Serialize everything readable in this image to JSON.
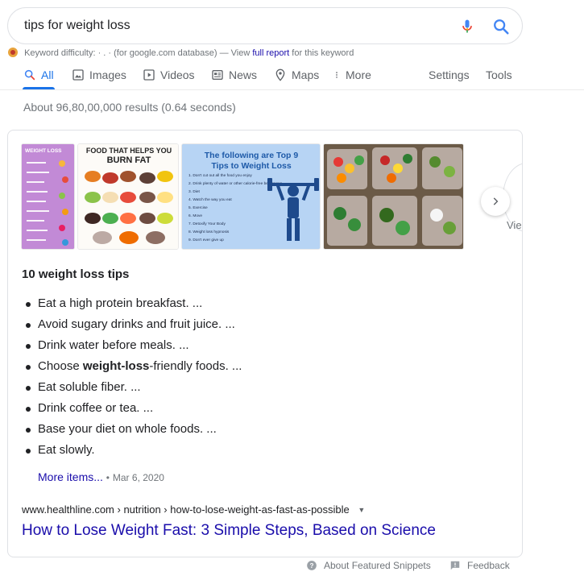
{
  "search": {
    "query": "tips for weight loss"
  },
  "keyword_difficulty": {
    "label": "Keyword difficulty:",
    "value": "· . ·",
    "note": "(for google.com database) — View",
    "link": "full report",
    "tail": "for this keyword"
  },
  "tabs": {
    "all": "All",
    "images": "Images",
    "videos": "Videos",
    "news": "News",
    "maps": "Maps",
    "more": "More",
    "settings": "Settings",
    "tools": "Tools"
  },
  "results_count": "About 96,80,00,000 results (0.64 seconds)",
  "images": [
    {
      "title": "WEIGHT LOSS",
      "icon": "weight-loss-checklist-image"
    },
    {
      "title": "FOOD THAT HELPS YOU",
      "title2": "BURN FAT",
      "icon": "fat-burning-food-image"
    },
    {
      "title": "The following are Top 9",
      "title2": "Tips to Weight Loss",
      "icon": "top-nine-tips-image",
      "tips": [
        "1.  Don't cut out all the food you enjoy",
        "2.  Drink plenty of water or other calorie-free beverages",
        "3.  Diet",
        "4.  Watch the way you eat",
        "5.  Exercise",
        "6.  Move",
        "7.  Detoxify Your Body",
        "8.  Weight loss hypnosis",
        "9.  Don't ever give up"
      ]
    },
    {
      "title": "",
      "icon": "meal-prep-containers-image"
    }
  ],
  "view_all": "Vie",
  "snippet": {
    "title": "10 weight loss tips",
    "items": [
      {
        "text": "Eat a high protein breakfast. ..."
      },
      {
        "text": "Avoid sugary drinks and fruit juice. ..."
      },
      {
        "text": "Drink water before meals. ..."
      },
      {
        "pre": "Choose ",
        "bold": "weight-loss",
        "post": "-friendly foods. ..."
      },
      {
        "text": "Eat soluble fiber. ..."
      },
      {
        "text": "Drink coffee or tea. ..."
      },
      {
        "text": "Base your diet on whole foods. ..."
      },
      {
        "text": "Eat slowly."
      }
    ],
    "more_items": "More items...",
    "separator": "•",
    "date": "Mar 6, 2020"
  },
  "result": {
    "cite": "www.healthline.com › nutrition › how-to-lose-weight-as-fast-as-possible",
    "title": "How to Lose Weight Fast: 3 Simple Steps, Based on Science"
  },
  "footer": {
    "about": "About Featured Snippets",
    "feedback": "Feedback"
  },
  "colors": {
    "accent": "#1a73e8",
    "link": "#1a0dab",
    "muted": "#70757a"
  }
}
